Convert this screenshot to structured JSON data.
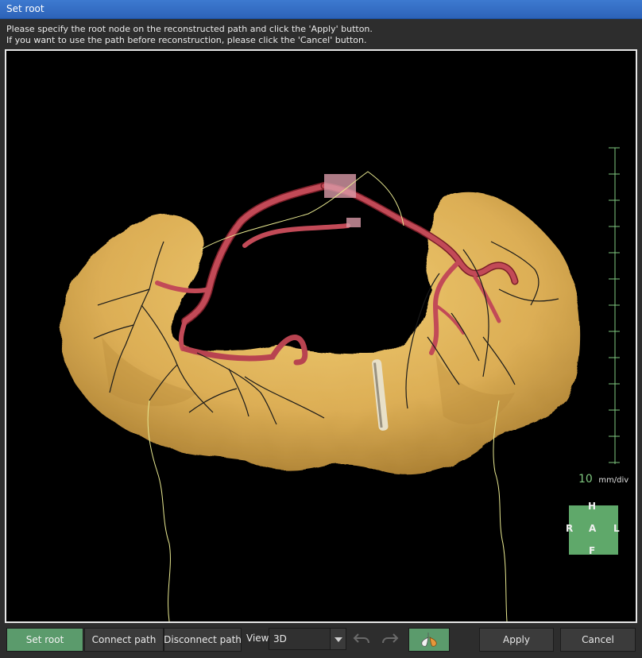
{
  "window": {
    "title": "Set root"
  },
  "instructions": {
    "line1": "Please specify the root node on the reconstructed path and click the 'Apply' button.",
    "line2": "If you want to use the path before reconstruction, please click the 'Cancel' button."
  },
  "scale": {
    "value": "10",
    "unit": "mm/div"
  },
  "orientation": {
    "top": "H",
    "left": "R",
    "center": "A",
    "right": "L",
    "bottom": "F"
  },
  "toolbar": {
    "set_root": "Set root",
    "connect_path": "Connect path",
    "disconnect_path": "Disconnect path",
    "view_label": "View",
    "view_value": "3D",
    "apply": "Apply",
    "cancel": "Cancel"
  },
  "colors": {
    "organ": "#e2b75b",
    "vessel": "#b8404c",
    "path_line": "#e8e890",
    "active_button": "#5b9b6c",
    "orientation_cube": "#5fa86a"
  },
  "icons": {
    "undo": "undo-icon",
    "redo": "redo-icon",
    "organ_toggle": "lung-display-icon",
    "dropdown": "chevron-down-icon"
  }
}
